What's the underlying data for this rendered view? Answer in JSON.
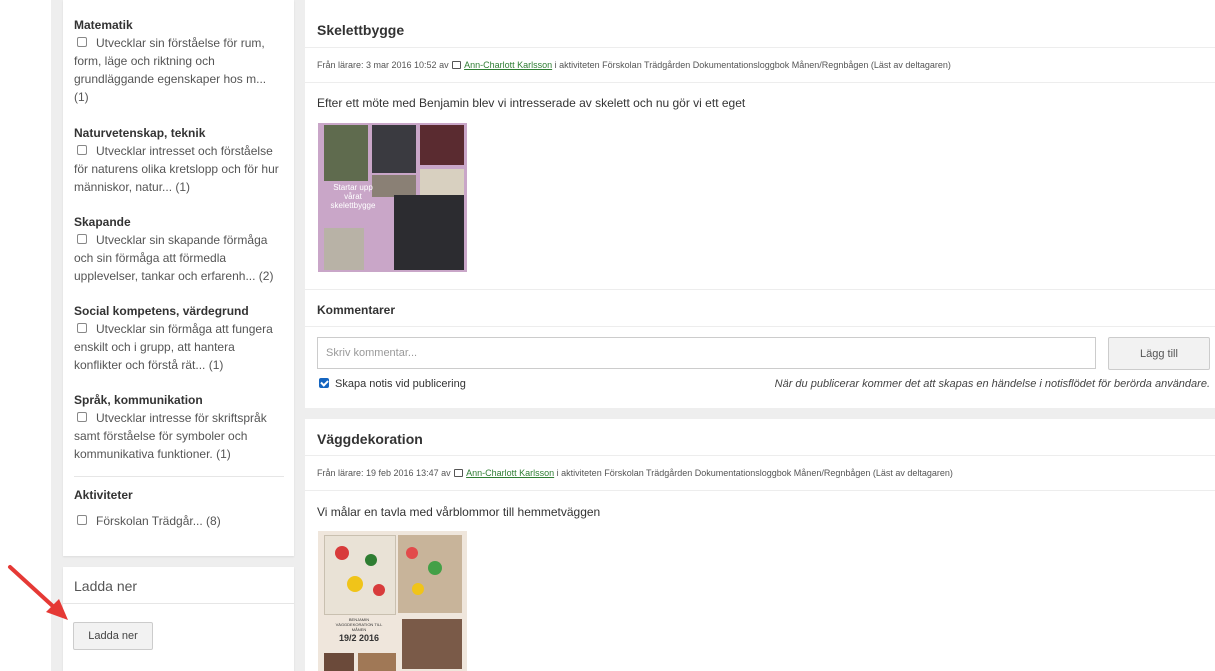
{
  "filters": {
    "categories": [
      {
        "title": "Matematik",
        "items": [
          {
            "lines": [
              "Utvecklar sin förståelse för rum,",
              "form, läge och riktning och",
              "grundläggande egenskaper hos m...",
              "(1)"
            ]
          }
        ]
      },
      {
        "title": "Naturvetenskap, teknik",
        "items": [
          {
            "lines": [
              "Utvecklar intresset och förståelse",
              "för naturens olika kretslopp och för hur",
              "människor, natur... (1)"
            ]
          }
        ]
      },
      {
        "title": "Skapande",
        "items": [
          {
            "lines": [
              "Utvecklar sin skapande förmåga",
              "och sin förmåga att förmedla",
              "upplevelser, tankar och erfarenh... (2)"
            ]
          }
        ]
      },
      {
        "title": "Social kompetens, värdegrund",
        "items": [
          {
            "lines": [
              "Utvecklar sin förmåga att fungera",
              "enskilt och i grupp, att hantera",
              "konflikter och förstå rät... (1)"
            ]
          }
        ]
      },
      {
        "title": "Språk, kommunikation",
        "items": [
          {
            "lines": [
              "Utvecklar intresse för skriftspråk",
              "samt förståelse för symboler och",
              "kommunikativa funktioner. (1)"
            ]
          }
        ]
      }
    ],
    "activities": {
      "title": "Aktiviteter",
      "item": "Förskolan Trädgår... (8)"
    }
  },
  "download": {
    "title": "Ladda ner",
    "button": "Ladda ner"
  },
  "posts": [
    {
      "title": "Skelettbygge",
      "meta_prefix": "Från lärare: 3 mar 2016 10:52 av",
      "author": "Ann-Charlott Karlsson",
      "meta_suffix": "i aktiviteten Förskolan Trädgården Dokumentationsloggbok Månen/Regnbågen (Läst av deltagaren)",
      "text": "Efter ett möte med Benjamin blev vi intresserade av skelett och nu gör vi ett eget",
      "image_caption": [
        "Startar upp",
        "vårat",
        "skelettbygge"
      ]
    },
    {
      "title": "Väggdekoration",
      "meta_prefix": "Från lärare: 19 feb 2016 13:47 av",
      "author": "Ann-Charlott Karlsson",
      "meta_suffix": "i aktiviteten Förskolan Trädgården Dokumentationsloggbok Månen/Regnbågen (Läst av deltagaren)",
      "text": "Vi målar en tavla med vårblommor till hemmetväggen",
      "image_caption": [
        "BENJAMIN",
        "VÄGGDEKORATION TILL",
        "MÅNEN",
        "19/2 2016"
      ]
    }
  ],
  "comments": {
    "title": "Kommentarer",
    "placeholder": "Skriv kommentar...",
    "add_button": "Lägg till",
    "notify_label": "Skapa notis vid publicering",
    "notify_note": "När du publicerar kommer det att skapas en händelse i notisflödet för berörda användare."
  },
  "colors": {
    "link": "#2e7d32",
    "checkbox": "#1565c0",
    "arrow": "#e53935",
    "page_bg": "#eeeeee"
  },
  "icons": {
    "comment": "comment-icon",
    "annotation": "red-arrow"
  }
}
